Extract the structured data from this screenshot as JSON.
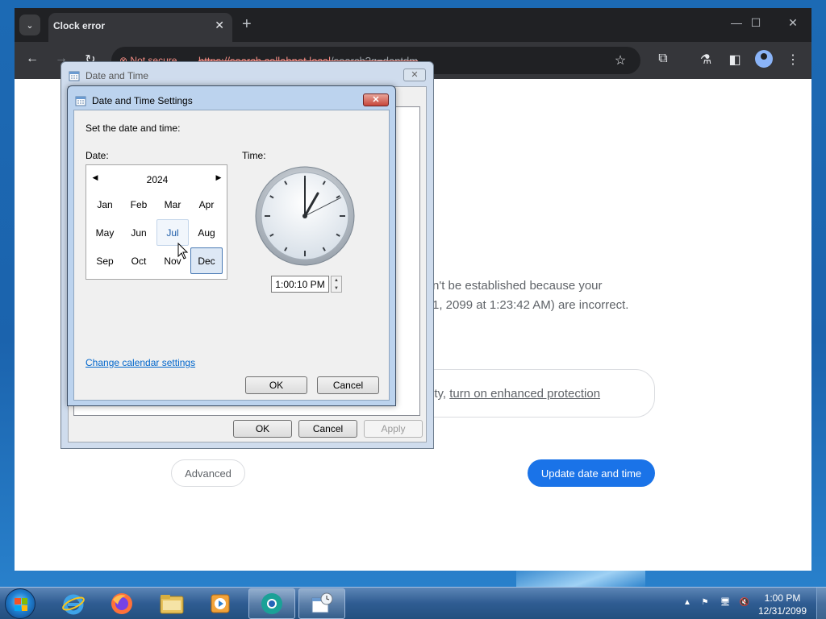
{
  "browser": {
    "tab_title": "Clock error",
    "tab_close": "✕",
    "new_tab": "+",
    "security_chip": "Not secure",
    "url_host": "https://search.collabnet.local",
    "url_path": "/search?q=dantdm"
  },
  "error_page": {
    "line1": "n't be established because your",
    "line2": "1, 2099 at 1:23:42 AM) are incorrect.",
    "safe_browsing_prefix": "ity,",
    "safe_browsing_link": "turn on enhanced protection",
    "advanced_button": "Advanced",
    "update_button": "Update date and time"
  },
  "date_time_dialog": {
    "title": "Date and Time",
    "ok": "OK",
    "cancel": "Cancel",
    "apply": "Apply"
  },
  "settings_dialog": {
    "title": "Date and Time Settings",
    "instruction": "Set the date and time:",
    "date_label": "Date:",
    "time_label": "Time:",
    "calendar": {
      "year": "2024",
      "months": [
        "Jan",
        "Feb",
        "Mar",
        "Apr",
        "May",
        "Jun",
        "Jul",
        "Aug",
        "Sep",
        "Oct",
        "Nov",
        "Dec"
      ],
      "selected_month": "Dec",
      "hovered_month": "Jul"
    },
    "time_value": "1:00:10 PM",
    "change_calendar_link": "Change calendar settings",
    "ok": "OK",
    "cancel": "Cancel"
  },
  "taskbar": {
    "clock_time": "1:00 PM",
    "clock_date": "12/31/2099",
    "apps": [
      "internet-explorer",
      "firefox",
      "file-explorer",
      "media-player",
      "chromium",
      "date-time-control-panel"
    ]
  },
  "colors": {
    "accent": "#1a73e8",
    "chrome_dark": "#202124",
    "error_red": "#f28b82"
  }
}
